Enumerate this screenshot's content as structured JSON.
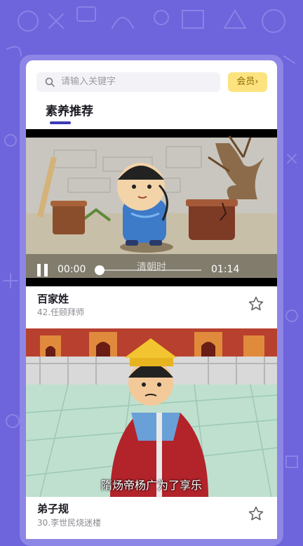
{
  "search": {
    "placeholder": "请输入关键字"
  },
  "vip_label": "会员",
  "vip_chevron": "›",
  "tab": {
    "label": "素养推荐"
  },
  "videos": [
    {
      "title": "百家姓",
      "episode": "42.任颐拜师",
      "player": {
        "current_time": "00:00",
        "duration": "01:14",
        "subtitle": "清朝时"
      }
    },
    {
      "title": "弟子规",
      "episode": "30.李世民烧迷楼",
      "subtitle": "隋炀帝杨广为了享乐"
    }
  ],
  "colors": {
    "background": "#6e64dc",
    "accent": "#3d3bb5",
    "vip_bg": "#fce37f"
  },
  "icons": [
    "search-icon",
    "pause-icon",
    "star-outline-icon",
    "chevron-right-icon"
  ]
}
